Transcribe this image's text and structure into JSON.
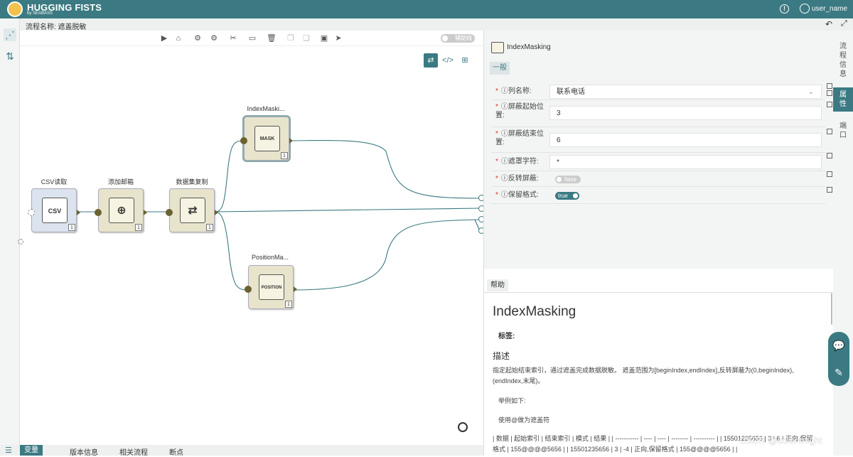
{
  "header": {
    "brand": "HUGGING FISTS",
    "brand_sub": "by SEABASS",
    "user_name": "user_name"
  },
  "flow": {
    "title": "流程名称: 遮盖脱敏"
  },
  "toolbar": {
    "aux_line_toggle": "辅助线"
  },
  "nodes": [
    {
      "label": "CSV读取",
      "icon_text": "CSV",
      "count": "1"
    },
    {
      "label": "添加邮箱",
      "icon_text": "⊕",
      "count": "1"
    },
    {
      "label": "数据集复制",
      "icon_text": "⇄",
      "count": "1"
    },
    {
      "label": "IndexMaski...",
      "icon_text": "MASK",
      "count": "1"
    },
    {
      "label": "PositionMa...",
      "icon_text": "POSITION",
      "count": "1"
    }
  ],
  "panel": {
    "node_title": "IndexMasking",
    "tab_general": "一般",
    "props": [
      {
        "label": "列名称:",
        "value": "联系电话",
        "type": "select"
      },
      {
        "label": "屏蔽起始位置:",
        "value": "3",
        "type": "input"
      },
      {
        "label": "屏蔽结束位置:",
        "value": "6",
        "type": "input"
      },
      {
        "label": "遮罩字符:",
        "value": "*",
        "type": "input"
      },
      {
        "label": "反转屏蔽:",
        "value": "false",
        "type": "switch"
      },
      {
        "label": "保留格式:",
        "value": "true",
        "type": "switch"
      }
    ],
    "help_tab": "帮助"
  },
  "help": {
    "title": "IndexMasking",
    "tag_label": "标签:",
    "desc_heading": "描述",
    "desc": "指定起始结束索引，通过遮盖完成数据脱敏。 遮盖范围为[beginIndex,endIndex],反转屏蔽为(0,beginIndex),(endIndex,末尾)。",
    "example": "举例如下:",
    "use": "使用@做为遮盖符",
    "table": "| 数据 | 起始索引 | 结束索引 | 模式 | 结果 | | ----------- | ---- | ---- | -------- | ---------- | | 15501235656 | 3 | 6 | 正向,保留格式 | 155@@@@5656 | | 15501235656 | 3 | -4 | 正向,保留格式 | 155@@@@5656 | |"
  },
  "right_tabs": [
    "流程信息",
    "属性",
    "端口"
  ],
  "bottom_tabs": [
    "变量",
    "版本信息",
    "相关流程",
    "断点"
  ],
  "watermark": "CSDN @colorknight",
  "colors": {
    "accent": "#3b7a82",
    "node": "#e8e4cc",
    "port": "#6b6230"
  }
}
